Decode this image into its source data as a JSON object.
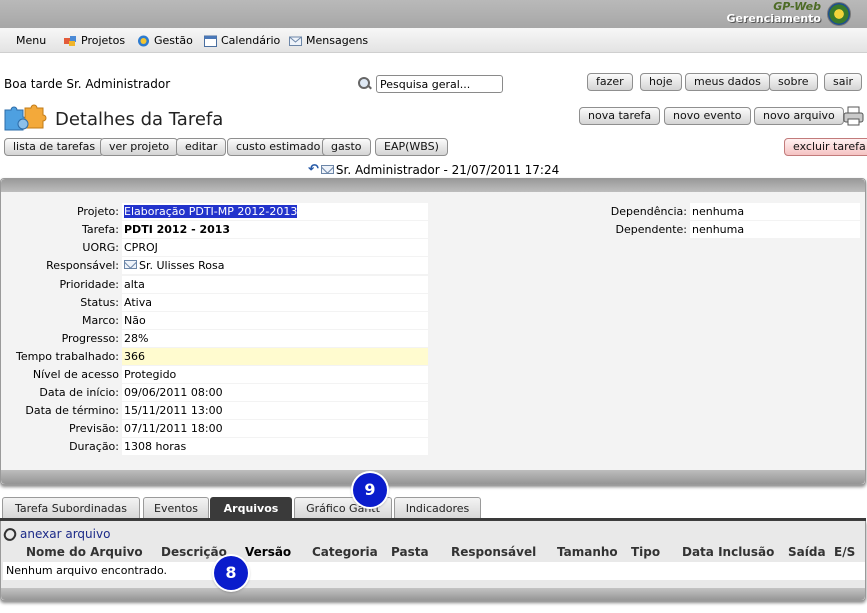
{
  "brand": {
    "line1": "GP-Web",
    "line2": "Gerenciamento"
  },
  "menu": [
    {
      "label": "Menu"
    },
    {
      "label": "Projetos"
    },
    {
      "label": "Gestão"
    },
    {
      "label": "Calendário"
    },
    {
      "label": "Mensagens"
    }
  ],
  "greeting": "Boa tarde Sr. Administrador",
  "search": {
    "placeholder": "Pesquisa geral..."
  },
  "top_buttons": {
    "fazer": "fazer",
    "hoje": "hoje",
    "meus_dados": "meus dados",
    "sobre": "sobre",
    "sair": "sair"
  },
  "page_title": "Detalhes da Tarefa",
  "action_buttons": {
    "nova_tarefa": "nova tarefa",
    "novo_evento": "novo evento",
    "novo_arquivo": "novo arquivo"
  },
  "toolbar": {
    "lista": "lista de tarefas",
    "ver_projeto": "ver projeto",
    "editar": "editar",
    "custo": "custo estimado",
    "gasto": "gasto",
    "eap": "EAP(WBS)",
    "excluir": "excluir tarefa"
  },
  "author_line": "Sr. Administrador - 21/07/2011 17:24",
  "details": [
    {
      "label": "Projeto:",
      "value": "Elaboração PDTI-MP 2012-2013"
    },
    {
      "label": "Tarefa:",
      "value": "PDTI 2012 - 2013"
    },
    {
      "label": "UORG:",
      "value": "CPROJ"
    },
    {
      "label": "Responsável:",
      "value": "Sr. Ulisses Rosa"
    },
    {
      "label": "Prioridade:",
      "value": "alta"
    },
    {
      "label": "Status:",
      "value": "Ativa"
    },
    {
      "label": "Marco:",
      "value": "Não"
    },
    {
      "label": "Progresso:",
      "value": "28%"
    },
    {
      "label": "Tempo trabalhado:",
      "value": "366"
    },
    {
      "label": "Nível de acesso",
      "value": "Protegido"
    },
    {
      "label": "Data de início:",
      "value": "09/06/2011 08:00"
    },
    {
      "label": "Data de término:",
      "value": "15/11/2011 13:00"
    },
    {
      "label": "Previsão:",
      "value": "07/11/2011 18:00"
    },
    {
      "label": "Duração:",
      "value": "1308 horas"
    }
  ],
  "dependencies": [
    {
      "label": "Dependência:",
      "value": "nenhuma"
    },
    {
      "label": "Dependente:",
      "value": "nenhuma"
    }
  ],
  "tabs": [
    "Tarefa Subordinadas",
    "Eventos",
    "Arquivos",
    "Gráfico Gantt",
    "Indicadores"
  ],
  "files": {
    "attach_label": "anexar arquivo",
    "columns": [
      "Nome do Arquivo",
      "Descrição",
      "Versão",
      "Categoria",
      "Pasta",
      "Responsável",
      "Tamanho",
      "Tipo",
      "Data Inclusão",
      "Saída",
      "E/S"
    ],
    "empty_message": "Nenhum arquivo encontrado."
  },
  "badges": {
    "tabs": "9",
    "files": "8"
  },
  "colors": {
    "selection": "#2233cc",
    "highlight": "#fffbcf",
    "badge": "#0a1ccc",
    "active_tab": "#3a3a3a"
  }
}
